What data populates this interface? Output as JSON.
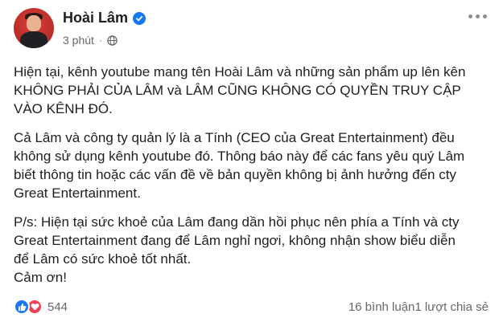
{
  "post": {
    "author": "Hoài Lâm",
    "time": "3 phút",
    "separator": "·",
    "privacy_icon": "globe-icon",
    "verified_icon": "verified-badge-icon",
    "paragraphs": [
      "Hiện tại, kênh youtube mang tên Hoài Lâm và những sản phẩm up lên kên\nKHÔNG PHẢI CỦA LÂM và LÂM CŨNG KHÔNG CÓ QUYỀN TRUY CẬP\nVÀO KÊNH ĐÓ.",
      "Cả Lâm và công ty quản lý là a Tính (CEO của Great Entertainment) đều\nkhông sử dụng kênh youtube đó. Thông báo này để các fans yêu quý Lâm\nbiết thông tin hoặc các vấn đề về bản quyền không bị ảnh hưởng đến cty\nGreat Entertainment.",
      "P/s: Hiện tại sức khoẻ của Lâm đang dần hồi phục nên phía a Tính và cty\nGreat Entertainment đang để Lâm nghỉ ngơi, không nhận show biểu diễn\nđể Lâm có sức khoẻ tốt nhất.\nCảm ơn!"
    ]
  },
  "footer": {
    "reaction_count": "544",
    "comments": "16 bình luận",
    "shares": "1 lượt chia sẻ"
  },
  "colors": {
    "like": "#1877f2",
    "love": "#f33e58",
    "meta": "#65676b"
  }
}
